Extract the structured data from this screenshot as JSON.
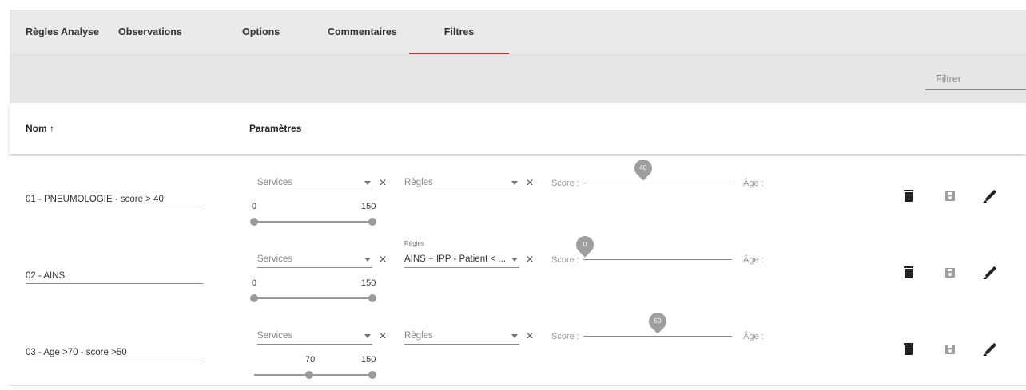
{
  "tabs": [
    {
      "label": "Règles Analyse"
    },
    {
      "label": "Observations"
    },
    {
      "label": "Options"
    },
    {
      "label": "Commentaires"
    },
    {
      "label": "Filtres",
      "active": true
    }
  ],
  "filter": {
    "placeholder": "Filtrer"
  },
  "table": {
    "headers": {
      "name": "Nom ↑",
      "params": "Paramètres"
    },
    "rows": [
      {
        "name": "01 - PNEUMOLOGIE  - score > 40",
        "services_placeholder": "Services",
        "regles_label": "",
        "regles_value": "Règles",
        "score_label": "Score :",
        "score_value": "40",
        "age_label": "Âge :",
        "age_min": "0",
        "age_max": "150"
      },
      {
        "name": "02 - AINS",
        "services_placeholder": "Services",
        "regles_label": "Règles",
        "regles_value": "AINS + IPP - Patient < ...",
        "score_label": "Score :",
        "score_value": "0",
        "age_label": "Âge :",
        "age_min": "0",
        "age_max": "150"
      },
      {
        "name": "03 - Age >70 - score >50",
        "services_placeholder": "Services",
        "regles_label": "",
        "regles_value": "Règles",
        "score_label": "Score :",
        "score_value": "50",
        "age_label": "Âge :",
        "age_min": "70",
        "age_max": "150"
      }
    ]
  },
  "colors": {
    "accent": "#d32f2f"
  },
  "icons": {
    "delete": "trash-icon",
    "save": "save-icon",
    "edit": "pencil-icon",
    "clear": "close-icon",
    "dropdown": "caret-down-icon",
    "sort": "arrow-up-icon"
  }
}
